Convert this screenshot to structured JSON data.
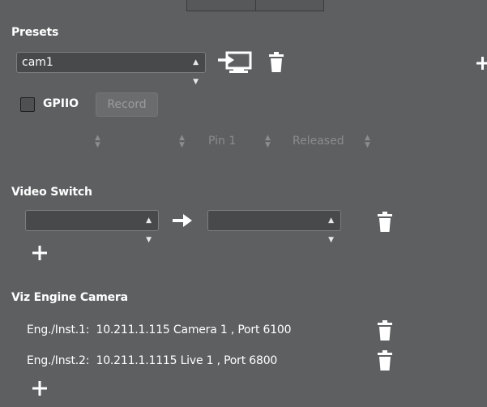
{
  "presets": {
    "title": "Presets",
    "selected": "cam1",
    "load_icon": "load-preset-icon",
    "delete_icon": "trash-icon",
    "add_icon": "plus-icon"
  },
  "gpio": {
    "label": "GPIIO",
    "record_label": "Record",
    "pin_value": "Pin 1",
    "state_value": "Released"
  },
  "video_switch": {
    "title": "Video Switch",
    "source_value": "",
    "target_value": "",
    "arrow_icon": "arrow-right-icon",
    "delete_icon": "trash-icon",
    "add_icon": "plus-icon"
  },
  "viz_engine_camera": {
    "title": "Viz Engine Camera",
    "rows": [
      {
        "label": "Eng./Inst.1:",
        "value": "10.211.1.115 Camera 1 , Port 6100"
      },
      {
        "label": "Eng./Inst.2:",
        "value": "10.211.1.1115 Live 1 , Port 6800"
      }
    ],
    "delete_icon": "trash-icon",
    "add_icon": "plus-icon"
  },
  "colors": {
    "background": "#5d5f60",
    "field_background": "#47494a",
    "field_border": "#7c7e7f",
    "disabled_text": "#8a8c8d"
  }
}
